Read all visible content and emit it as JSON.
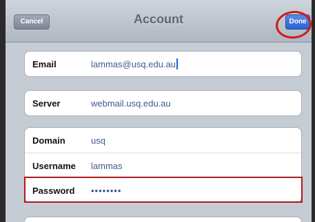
{
  "navbar": {
    "title": "Account",
    "cancel_label": "Cancel",
    "done_label": "Done"
  },
  "fields": {
    "email": {
      "label": "Email",
      "value": "lammas@usq.edu.au"
    },
    "server": {
      "label": "Server",
      "value": "webmail.usq.edu.au"
    },
    "domain": {
      "label": "Domain",
      "value": "usq"
    },
    "username": {
      "label": "Username",
      "value": "lammas"
    },
    "password": {
      "label": "Password",
      "value": "••••••••"
    }
  },
  "annotations": {
    "done_circle_color": "#d01818",
    "password_box_color": "#b01818"
  }
}
